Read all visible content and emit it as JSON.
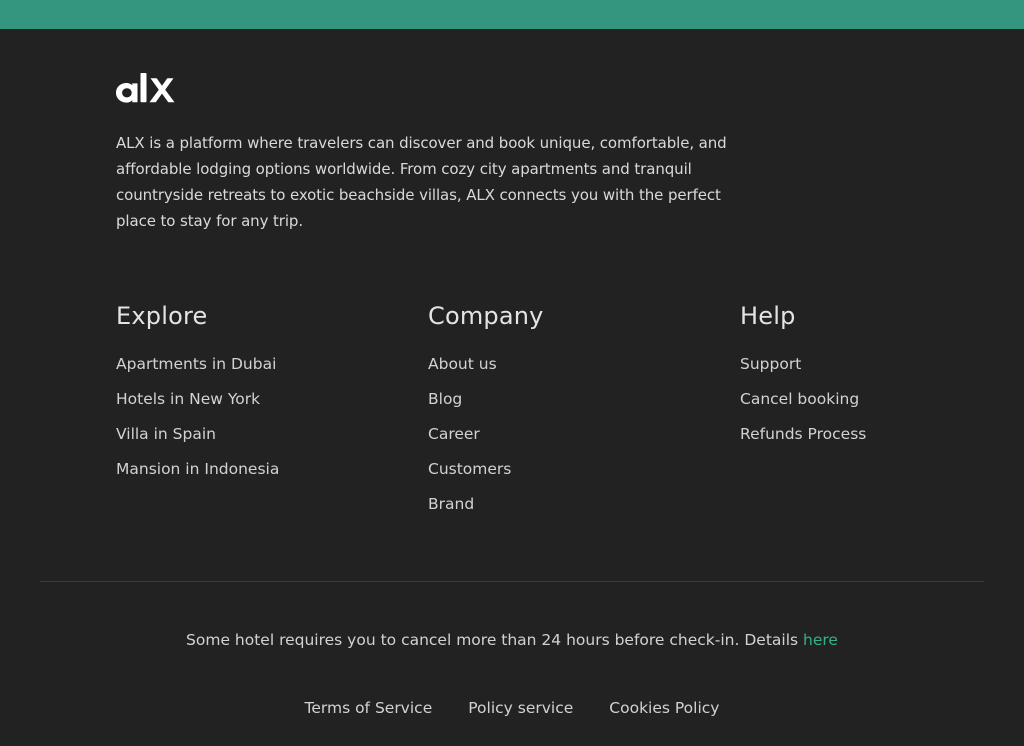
{
  "colors": {
    "top_bar": "#34967f",
    "background": "#222222",
    "link_accent": "#34b089",
    "text": "#d2d2d2"
  },
  "brand": {
    "logo_text": "alx",
    "logo_icon": "alx-logo"
  },
  "about": {
    "text": "ALX is a platform where travelers can discover and book unique, comfortable, and affordable lodging options worldwide. From cozy city apartments and tranquil countryside retreats to exotic beachside villas, ALX connects you with the perfect place to stay for any trip."
  },
  "columns": [
    {
      "title": "Explore",
      "links": [
        "Apartments in Dubai",
        "Hotels in New York",
        "Villa in Spain",
        "Mansion in Indonesia"
      ]
    },
    {
      "title": "Company",
      "links": [
        "About us",
        "Blog",
        "Career",
        "Customers",
        "Brand"
      ]
    },
    {
      "title": "Help",
      "links": [
        "Support",
        "Cancel booking",
        "Refunds Process"
      ]
    }
  ],
  "notice": {
    "text": "Some hotel requires you to cancel more than 24 hours before check-in. Details ",
    "link_label": "here"
  },
  "legal": {
    "links": [
      "Terms of Service",
      "Policy service",
      "Cookies Policy"
    ]
  }
}
